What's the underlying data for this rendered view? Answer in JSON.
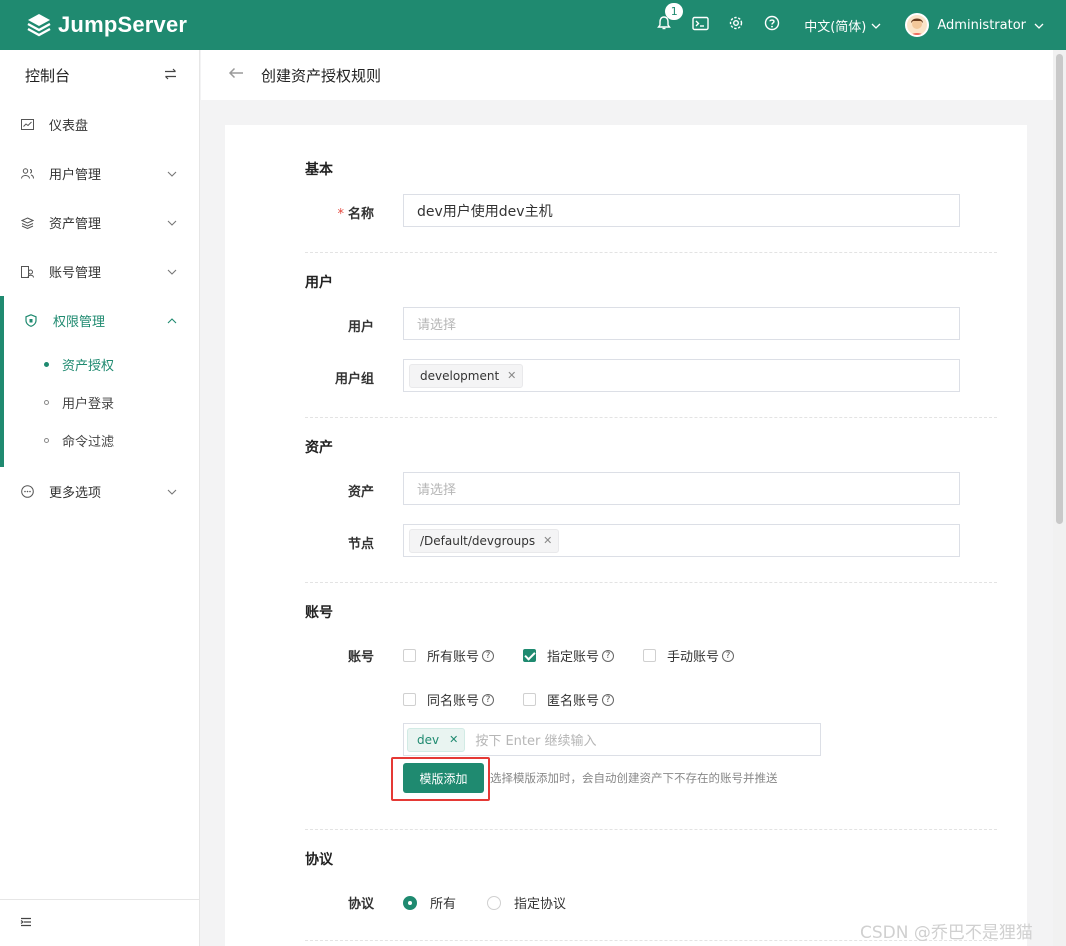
{
  "app": {
    "logo_text": "JumpServer"
  },
  "topbar": {
    "notification_count": "1",
    "language": "中文(简体)",
    "user_name": "Administrator"
  },
  "sidebar": {
    "title": "控制台",
    "items": [
      {
        "label": "仪表盘",
        "icon": "dashboard-icon"
      },
      {
        "label": "用户管理",
        "icon": "users-icon"
      },
      {
        "label": "资产管理",
        "icon": "stack-icon"
      },
      {
        "label": "账号管理",
        "icon": "account-icon"
      },
      {
        "label": "权限管理",
        "icon": "shield-icon"
      },
      {
        "label": "更多选项",
        "icon": "more-icon"
      }
    ],
    "sub_items": [
      {
        "label": "资产授权"
      },
      {
        "label": "用户登录"
      },
      {
        "label": "命令过滤"
      }
    ]
  },
  "page": {
    "title": "创建资产授权规则"
  },
  "form": {
    "sections": {
      "basic": "基本",
      "user": "用户",
      "asset": "资产",
      "account": "账号",
      "protocol": "协议"
    },
    "name_label": "名称",
    "name_value": "dev用户使用dev主机",
    "user_label": "用户",
    "user_placeholder": "请选择",
    "user_group_label": "用户组",
    "user_group_tag": "development",
    "asset_label": "资产",
    "asset_placeholder": "请选择",
    "node_label": "节点",
    "node_tag": "/Default/devgroups",
    "account_label": "账号",
    "account_options": [
      {
        "label": "所有账号",
        "checked": false
      },
      {
        "label": "指定账号",
        "checked": true
      },
      {
        "label": "手动账号",
        "checked": false
      },
      {
        "label": "同名账号",
        "checked": false
      },
      {
        "label": "匿名账号",
        "checked": false
      }
    ],
    "account_tag": "dev",
    "account_input_placeholder": "按下 Enter 继续输入",
    "template_button": "模版添加",
    "template_hint": "选择模版添加时，会自动创建资产下不存在的账号并推送",
    "protocol_label": "协议",
    "protocol_options": [
      {
        "label": "所有",
        "selected": true
      },
      {
        "label": "指定协议",
        "selected": false
      }
    ]
  },
  "watermark": "CSDN @乔巴不是狸猫",
  "colors": {
    "primary": "#1f8a70",
    "highlight": "#e53935"
  }
}
